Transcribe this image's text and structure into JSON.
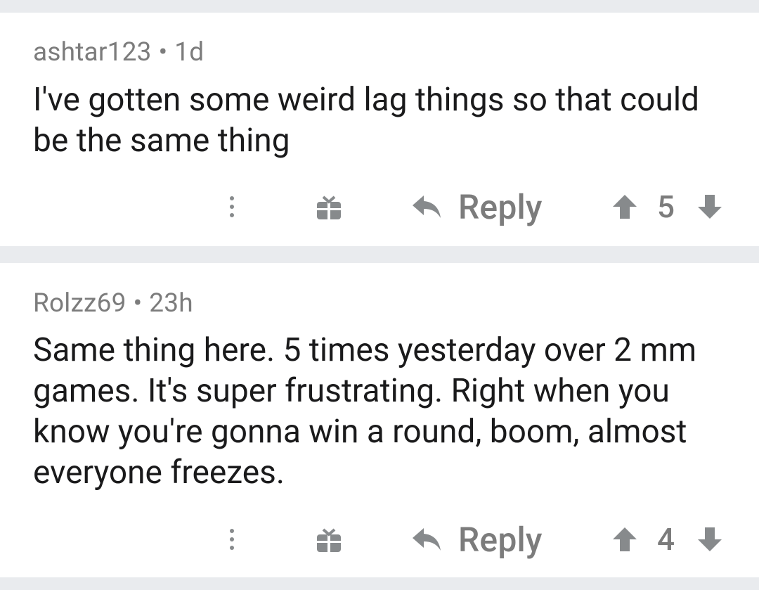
{
  "comments": [
    {
      "author": "ashtar123",
      "separator": "•",
      "age": "1d",
      "body": "I've gotten some weird lag things so that could be the same thing",
      "reply_label": "Reply",
      "score": "5"
    },
    {
      "author": "Rolzz69",
      "separator": "•",
      "age": "23h",
      "body": "Same thing here. 5 times yesterday over 2 mm games. It's super frustrating. Right when you know you're gonna win a round, boom, almost everyone freezes.",
      "reply_label": "Reply",
      "score": "4"
    }
  ],
  "icons": {
    "more": "more-vertical-icon",
    "gift": "gift-icon",
    "reply": "reply-arrow-icon",
    "upvote": "upvote-arrow-icon",
    "downvote": "downvote-arrow-icon"
  },
  "colors": {
    "background": "#e9ebee",
    "card": "#ffffff",
    "meta_text": "#7c7c7c",
    "body_text": "#1a1a1b",
    "icon": "#878a8c"
  }
}
